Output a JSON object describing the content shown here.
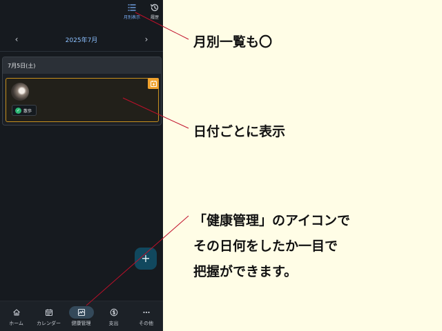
{
  "topbar": {
    "monthly_view_label": "月別表示",
    "history_label": "履歴"
  },
  "month_nav": {
    "prev": "‹",
    "current": "2025年7月",
    "next": "›"
  },
  "day": {
    "date": "7月5日(土)",
    "record": {
      "badge_label": "散歩"
    }
  },
  "fab_label": "+",
  "bottom_nav": [
    {
      "label": "ホーム",
      "icon": "home-icon"
    },
    {
      "label": "カレンダー",
      "icon": "calendar-icon"
    },
    {
      "label": "健康管理",
      "icon": "health-icon",
      "active": true
    },
    {
      "label": "支出",
      "icon": "dollar-icon"
    },
    {
      "label": "その他",
      "icon": "more-icon"
    }
  ],
  "annotations": {
    "monthly": "月別一覧も〇",
    "daily": "日付ごとに表示",
    "health_lines": [
      "「健康管理」のアイコンで",
      "その日何をしたか一目で",
      "把握ができます。"
    ]
  },
  "colors": {
    "app_bg": "#161a1f",
    "accent_blue": "#8cc0ff",
    "record_border": "#c8901e",
    "health_tag": "#f0a22e",
    "annotation_line": "#c0102a",
    "page_bg": "#fffde6"
  }
}
